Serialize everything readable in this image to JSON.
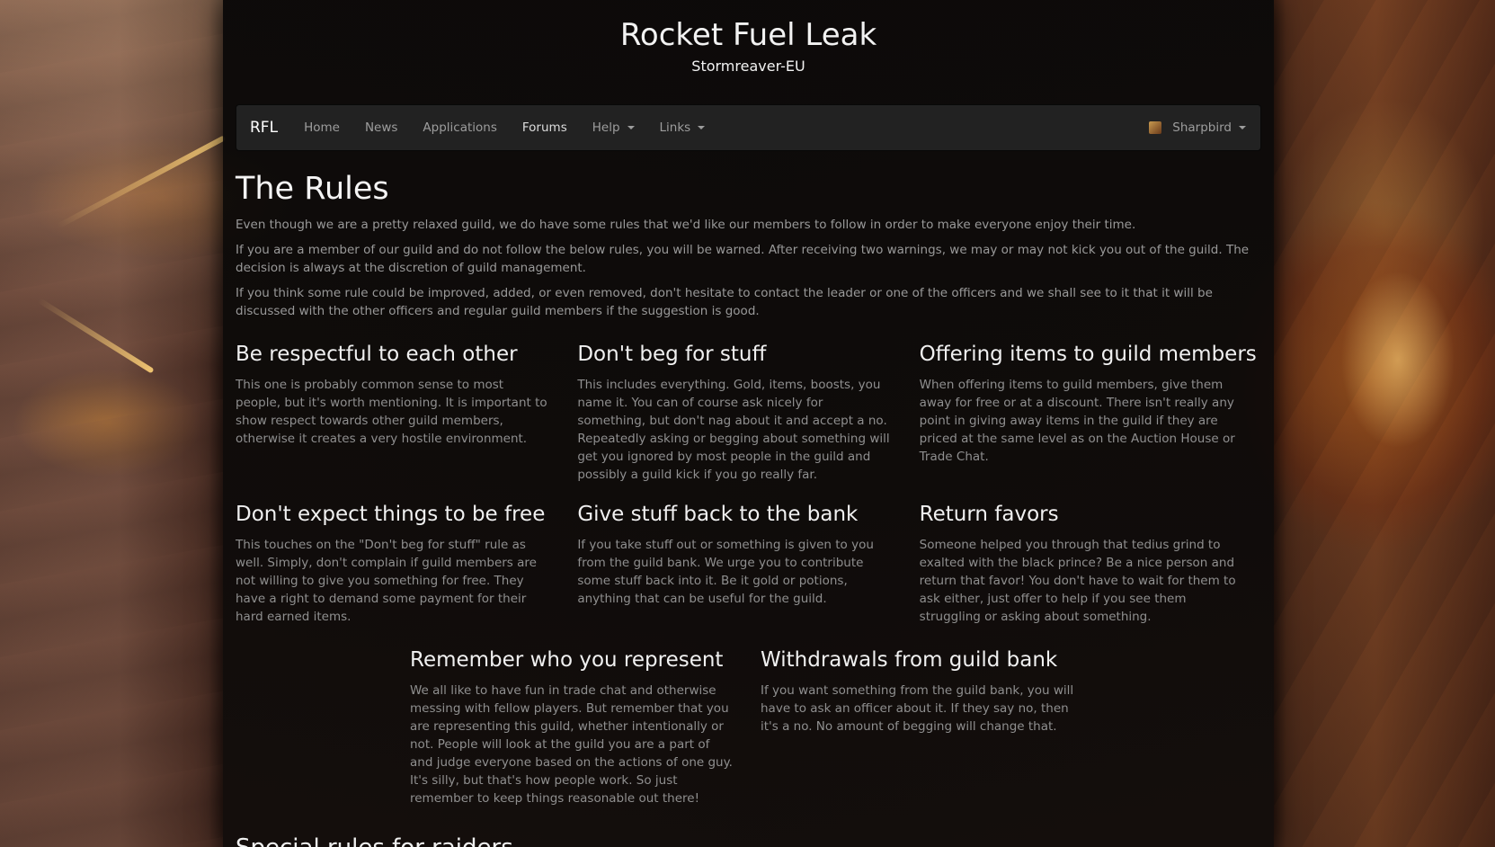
{
  "site": {
    "title": "Rocket Fuel Leak",
    "subtitle": "Stormreaver-EU"
  },
  "navbar": {
    "brand": "RFL",
    "items": [
      {
        "label": "Home"
      },
      {
        "label": "News"
      },
      {
        "label": "Applications"
      },
      {
        "label": "Forums"
      },
      {
        "label": "Help"
      },
      {
        "label": "Links"
      }
    ],
    "user": "Sharpbird"
  },
  "page": {
    "title": "The Rules",
    "intro": [
      "Even though we are a pretty relaxed guild, we do have some rules that we'd like our members to follow in order to make everyone enjoy their time.",
      "If you are a member of our guild and do not follow the below rules, you will be warned. After receiving two warnings, we may or may not kick you out of the guild. The decision is always at the discretion of guild management.",
      "If you think some rule could be improved, added, or even removed, don't hesitate to contact the leader or one of the officers and we shall see to it that it will be discussed with the other officers and regular guild members if the suggestion is good."
    ],
    "rules": [
      {
        "title": "Be respectful to each other",
        "text": "This one is probably common sense to most people, but it's worth mentioning. It is important to show respect towards other guild members, otherwise it creates a very hostile environment."
      },
      {
        "title": "Don't beg for stuff",
        "text": "This includes everything. Gold, items, boosts, you name it. You can of course ask nicely for something, but don't nag about it and accept a no. Repeatedly asking or begging about something will get you ignored by most people in the guild and possibly a guild kick if you go really far."
      },
      {
        "title": "Offering items to guild members",
        "text": "When offering items to guild members, give them away for free or at a discount. There isn't really any point in giving away items in the guild if they are priced at the same level as on the Auction House or Trade Chat."
      },
      {
        "title": "Don't expect things to be free",
        "text": "This touches on the \"Don't beg for stuff\" rule as well. Simply, don't complain if guild members are not willing to give you something for free. They have a right to demand some payment for their hard earned items."
      },
      {
        "title": "Give stuff back to the bank",
        "text": "If you take stuff out or something is given to you from the guild bank. We urge you to contribute some stuff back into it. Be it gold or potions, anything that can be useful for the guild."
      },
      {
        "title": "Return favors",
        "text": "Someone helped you through that tedius grind to exalted with the black prince? Be a nice person and return that favor! You don't have to wait for them to ask either, just offer to help if you see them struggling or asking about something."
      },
      {
        "title": "Remember who you represent",
        "text": "We all like to have fun in trade chat and otherwise messing with fellow players. But remember that you are representing this guild, whether intentionally or not. People will look at the guild you are a part of and judge everyone based on the actions of one guy. It's silly, but that's how people work. So just remember to keep things reasonable out there!"
      },
      {
        "title": "Withdrawals from guild bank",
        "text": "If you want something from the guild bank, you will have to ask an officer about it. If they say no, then it's a no. No amount of begging will change that."
      }
    ],
    "next_section": "Special rules for raiders"
  }
}
